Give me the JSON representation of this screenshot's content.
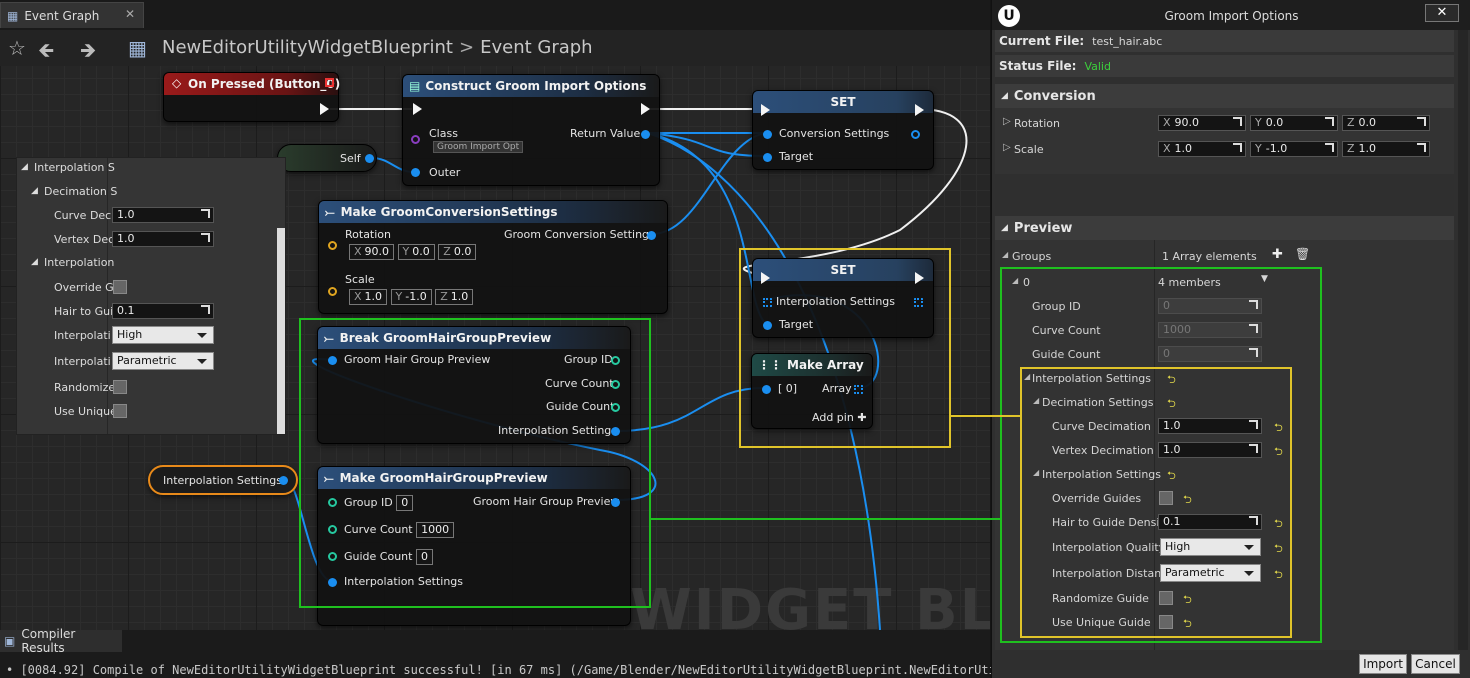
{
  "graph_tab": {
    "title": "Event Graph",
    "close": "✕"
  },
  "breadcrumb": {
    "blueprint": "NewEditorUtilityWidgetBlueprint",
    "separator": ">",
    "graph": "Event Graph"
  },
  "watermark": "WIDGET BLUEI",
  "nodes": {
    "on_pressed": {
      "title": "On Pressed (Button_0)"
    },
    "construct": {
      "title": "Construct Groom Import Options",
      "class_label": "Class",
      "class_value": "Groom Import Opt",
      "return_value": "Return Value",
      "outer": "Outer"
    },
    "self": {
      "label": "Self"
    },
    "set1": {
      "title": "SET",
      "pin_conversion": "Conversion Settings",
      "pin_target": "Target"
    },
    "set2": {
      "title": "SET",
      "pin_interp": "Interpolation Settings",
      "pin_target": "Target"
    },
    "make_conversion": {
      "title": "Make GroomConversionSettings",
      "rotation": "Rotation",
      "rx_k": "X",
      "rx": "90.0",
      "ry_k": "Y",
      "ry": "0.0",
      "rz_k": "Z",
      "rz": "0.0",
      "scale": "Scale",
      "sx_k": "X",
      "sx": "1.0",
      "sy_k": "Y",
      "sy": "-1.0",
      "sz_k": "Z",
      "sz": "1.0",
      "out": "Groom Conversion Settings"
    },
    "break_preview": {
      "title": "Break GroomHairGroupPreview",
      "in": "Groom Hair Group Preview",
      "group_id": "Group ID",
      "curve_count": "Curve Count",
      "guide_count": "Guide Count",
      "interp": "Interpolation Settings"
    },
    "make_preview": {
      "title": "Make GroomHairGroupPreview",
      "group_id": "Group ID",
      "group_id_v": "0",
      "curve_count": "Curve Count",
      "curve_count_v": "1000",
      "guide_count": "Guide Count",
      "guide_count_v": "0",
      "interp": "Interpolation Settings",
      "out": "Groom Hair Group Preview"
    },
    "make_array": {
      "title": "Make Array",
      "idx": "[ 0]",
      "array": "Array",
      "add_pin": "Add pin",
      "plus": "✚"
    },
    "interp_var": {
      "label": "Interpolation Settings"
    }
  },
  "float_panel": {
    "interp_s": "Interpolation S",
    "decimation_s": "Decimation S",
    "curve_deci": "Curve Deci",
    "curve_deci_v": "1.0",
    "vertex_dec": "Vertex Dec",
    "vertex_dec_v": "1.0",
    "interpolation": "Interpolation",
    "override_g": "Override G",
    "hair_to_gui": "Hair to Gui",
    "hair_to_gui_v": "0.1",
    "interpolati_1": "Interpolati",
    "interpolati_1_v": "High",
    "interpolati_2": "Interpolati",
    "interpolati_2_v": "Parametric",
    "randomize": "Randomize",
    "use_unique": "Use Unique"
  },
  "compiler": {
    "title": "Compiler Results",
    "message": "[0084.92] Compile of NewEditorUtilityWidgetBlueprint successful! [in 67 ms] (/Game/Blender/NewEditorUtilityWidgetBlueprint.NewEditorUtilit"
  },
  "dialog": {
    "title": "Groom Import Options",
    "logo": "U",
    "close": "✕",
    "current_file_label": "Current File:",
    "current_file": "test_hair.abc",
    "status_file_label": "Status File:",
    "status_file": "Valid",
    "conversion": {
      "header": "Conversion",
      "rotation": "Rotation",
      "rot_x_k": "X",
      "rot_x": "90.0",
      "rot_y_k": "Y",
      "rot_y": "0.0",
      "rot_z_k": "Z",
      "rot_z": "0.0",
      "scale": "Scale",
      "sc_x_k": "X",
      "sc_x": "1.0",
      "sc_y_k": "Y",
      "sc_y": "-1.0",
      "sc_z_k": "Z",
      "sc_z": "1.0"
    },
    "preview": {
      "header": "Preview",
      "groups": "Groups",
      "groups_value": "1 Array elements",
      "add": "✚",
      "trash": "🗑",
      "index": "0",
      "members": "4 members",
      "group_id": "Group ID",
      "group_id_v": "0",
      "curve_count": "Curve Count",
      "curve_count_v": "1000",
      "guide_count": "Guide Count",
      "guide_count_v": "0",
      "interp_settings": "Interpolation Settings",
      "decimation_settings": "Decimation Settings",
      "curve_decimation": "Curve Decimation",
      "curve_decimation_v": "1.0",
      "vertex_decimation": "Vertex Decimation",
      "vertex_decimation_v": "1.0",
      "interp_settings_inner": "Interpolation Settings",
      "override_guides": "Override Guides",
      "hair_to_guide": "Hair to Guide Density",
      "hair_to_guide_v": "0.1",
      "interp_quality": "Interpolation Quality",
      "interp_quality_v": "High",
      "interp_distance": "Interpolation Distanc",
      "interp_distance_v": "Parametric",
      "randomize_guide": "Randomize Guide",
      "use_unique_guide": "Use Unique Guide",
      "reset_glyph": "⮌"
    },
    "import_button": "Import",
    "cancel_button": "Cancel"
  },
  "colors": {
    "highlight_green": "#1fc01f",
    "highlight_yellow": "#e0c42a",
    "status_valid": "#3ccf3c",
    "pin_blue": "#1a8ef0"
  }
}
